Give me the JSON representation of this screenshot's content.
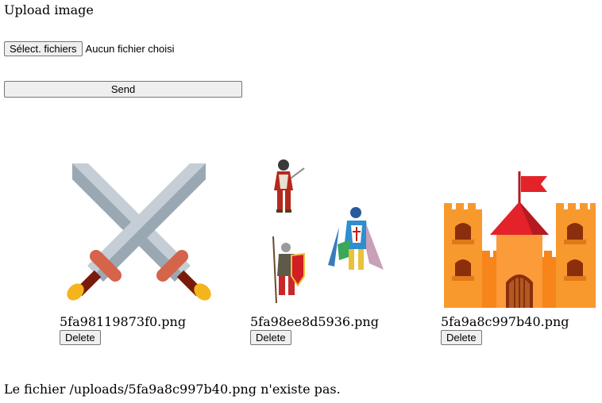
{
  "form": {
    "title": "Upload image",
    "select_label": "Sélect. fichiers",
    "no_file_text": "Aucun fichier choisi",
    "send_label": "Send"
  },
  "gallery": [
    {
      "filename": "5fa98119873f0.png",
      "delete_label": "Delete",
      "icon": "crossed-swords-icon"
    },
    {
      "filename": "5fa98ee8d5936.png",
      "delete_label": "Delete",
      "icon": "knights-icon"
    },
    {
      "filename": "5fa9a8c997b40.png",
      "delete_label": "Delete",
      "icon": "castle-icon"
    }
  ],
  "message": "Le fichier /uploads/5fa9a8c997b40.png n'existe pas."
}
